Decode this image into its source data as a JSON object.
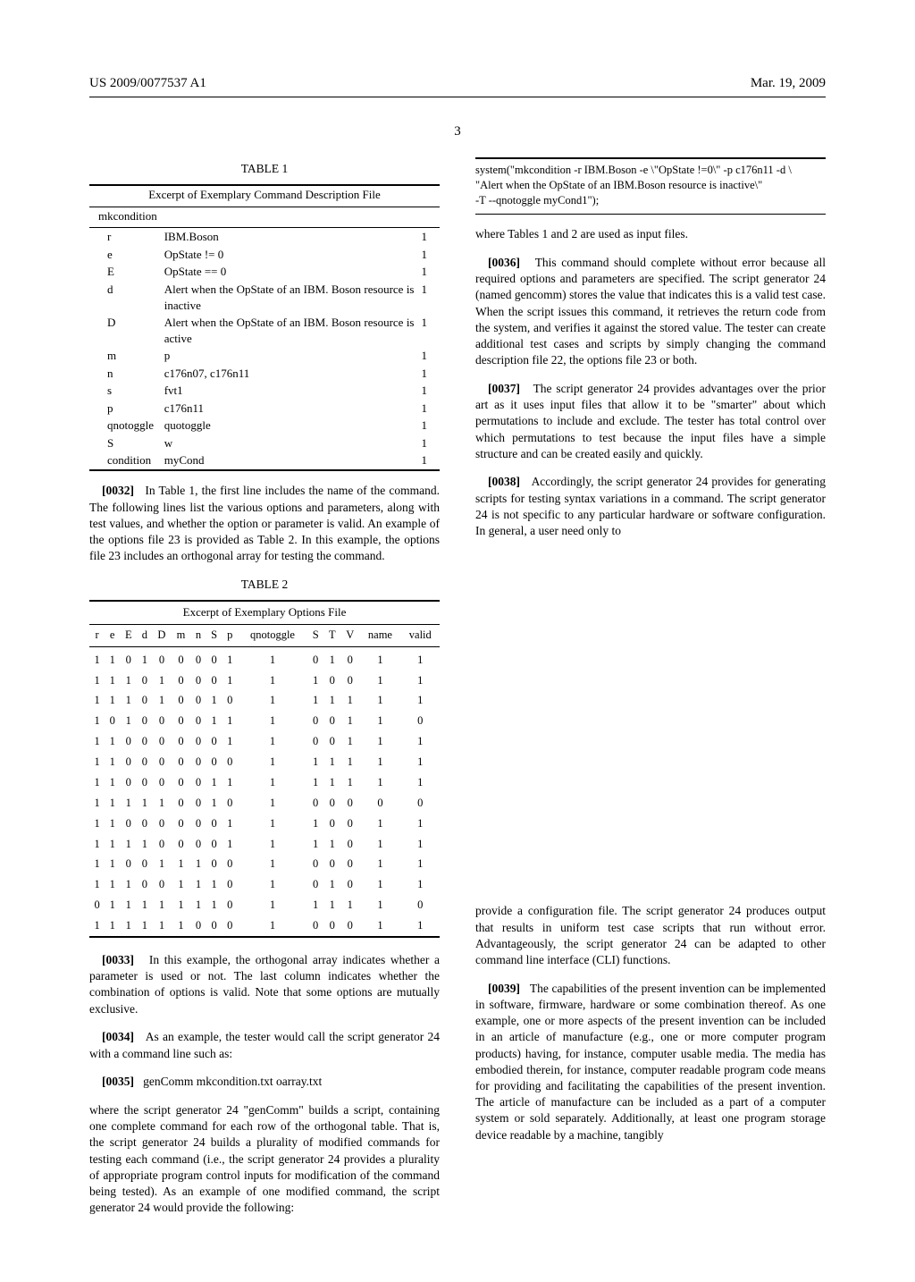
{
  "header": {
    "docnum": "US 2009/0077537 A1",
    "date": "Mar. 19, 2009",
    "page": "3"
  },
  "table1": {
    "title": "TABLE 1",
    "subtitle": "Excerpt of Exemplary Command Description File",
    "cmdname": "mkcondition",
    "rows": [
      {
        "opt": "r",
        "val": "IBM.Boson",
        "f": "1"
      },
      {
        "opt": "e",
        "val": "OpState != 0",
        "f": "1"
      },
      {
        "opt": "E",
        "val": "OpState == 0",
        "f": "1"
      },
      {
        "opt": "d",
        "val": "Alert when the OpState of an IBM. Boson resource is inactive",
        "f": "1"
      },
      {
        "opt": "D",
        "val": "Alert when the OpState of an IBM. Boson resource is active",
        "f": "1"
      },
      {
        "opt": "m",
        "val": "p",
        "f": "1"
      },
      {
        "opt": "n",
        "val": "c176n07, c176n11",
        "f": "1"
      },
      {
        "opt": "s",
        "val": "fvt1",
        "f": "1"
      },
      {
        "opt": "p",
        "val": "c176n11",
        "f": "1"
      },
      {
        "opt": "qnotoggle",
        "val": "quotoggle",
        "f": "1"
      },
      {
        "opt": "S",
        "val": "w",
        "f": "1"
      },
      {
        "opt": "condition",
        "val": "myCond",
        "f": "1"
      }
    ]
  },
  "para32": {
    "num": "[0032]",
    "text": "In Table 1, the first line includes the name of the command. The following lines list the various options and parameters, along with test values, and whether the option or parameter is valid. An example of the options file 23 is provided as Table 2. In this example, the options file 23 includes an orthogonal array for testing the command."
  },
  "table2": {
    "title": "TABLE 2",
    "subtitle": "Excerpt of Exemplary Options File",
    "headers": [
      "r",
      "e",
      "E",
      "d",
      "D",
      "m",
      "n",
      "S",
      "p",
      "qnotoggle",
      "S",
      "T",
      "V",
      "name",
      "valid"
    ]
  },
  "chart_data": {
    "type": "table",
    "columns": [
      "r",
      "e",
      "E",
      "d",
      "D",
      "m",
      "n",
      "S",
      "p",
      "qnotoggle",
      "S",
      "T",
      "V",
      "name",
      "valid"
    ],
    "rows": [
      [
        1,
        1,
        0,
        1,
        0,
        0,
        0,
        0,
        1,
        1,
        0,
        1,
        0,
        1,
        1
      ],
      [
        1,
        1,
        1,
        0,
        1,
        0,
        0,
        0,
        1,
        1,
        1,
        0,
        0,
        1,
        1
      ],
      [
        1,
        1,
        1,
        0,
        1,
        0,
        0,
        1,
        0,
        1,
        1,
        1,
        1,
        1,
        1
      ],
      [
        1,
        0,
        1,
        0,
        0,
        0,
        0,
        1,
        1,
        1,
        0,
        0,
        1,
        1,
        0
      ],
      [
        1,
        1,
        0,
        0,
        0,
        0,
        0,
        0,
        1,
        1,
        0,
        0,
        1,
        1,
        1
      ],
      [
        1,
        1,
        0,
        0,
        0,
        0,
        0,
        0,
        0,
        1,
        1,
        1,
        1,
        1,
        1
      ],
      [
        1,
        1,
        0,
        0,
        0,
        0,
        0,
        1,
        1,
        1,
        1,
        1,
        1,
        1,
        1
      ],
      [
        1,
        1,
        1,
        1,
        1,
        0,
        0,
        1,
        0,
        1,
        0,
        0,
        0,
        0,
        0
      ],
      [
        1,
        1,
        0,
        0,
        0,
        0,
        0,
        0,
        1,
        1,
        1,
        0,
        0,
        1,
        1
      ],
      [
        1,
        1,
        1,
        1,
        0,
        0,
        0,
        0,
        1,
        1,
        1,
        1,
        0,
        1,
        1
      ],
      [
        1,
        1,
        0,
        0,
        1,
        1,
        1,
        0,
        0,
        1,
        0,
        0,
        0,
        1,
        1
      ],
      [
        1,
        1,
        1,
        0,
        0,
        1,
        1,
        1,
        0,
        1,
        0,
        1,
        0,
        1,
        1
      ],
      [
        0,
        1,
        1,
        1,
        1,
        1,
        1,
        1,
        0,
        1,
        1,
        1,
        1,
        1,
        0
      ],
      [
        1,
        1,
        1,
        1,
        1,
        1,
        0,
        0,
        0,
        1,
        0,
        0,
        0,
        1,
        1
      ]
    ]
  },
  "para33": {
    "num": "[0033]",
    "text": "In this example, the orthogonal array indicates whether a parameter is used or not. The last column indicates whether the combination of options is valid. Note that some options are mutually exclusive."
  },
  "para34": {
    "num": "[0034]",
    "text": "As an example, the tester would call the script generator 24 with a command line such as:"
  },
  "para35": {
    "num": "[0035]",
    "cmdline": "genComm mkcondition.txt oarray.txt",
    "text": "where the script generator 24 \"genComm\" builds a script, containing one complete command for each row of the orthogonal table. That is, the script generator 24 builds a plurality of modified commands for testing each command (i.e., the script generator 24 provides a plurality of appropriate program control inputs for modification of the command being tested). As an example of one modified command, the script generator 24 would provide the following:"
  },
  "codebox": {
    "l1": "system(\"mkcondition -r IBM.Boson -e \\\"OpState !=0\\\" -p c176n11 -d \\",
    "l2": "\"Alert when the OpState of an IBM.Boson resource is inactive\\\"",
    "l3": "-T --qnotoggle myCond1\");"
  },
  "para35b": "where Tables 1 and 2 are used as input files.",
  "para36": {
    "num": "[0036]",
    "text": "This command should complete without error because all required options and parameters are specified. The script generator 24 (named gencomm) stores the value that indicates this is a valid test case. When the script issues this command, it retrieves the return code from the system, and verifies it against the stored value. The tester can create additional test cases and scripts by simply changing the command description file 22, the options file 23 or both."
  },
  "para37": {
    "num": "[0037]",
    "text": "The script generator 24 provides advantages over the prior art as it uses input files that allow it to be \"smarter\" about which permutations to include and exclude. The tester has total control over which permutations to test because the input files have a simple structure and can be created easily and quickly."
  },
  "para38": {
    "num": "[0038]",
    "text": "Accordingly, the script generator 24 provides for generating scripts for testing syntax variations in a command. The script generator 24 is not specific to any particular hardware or software configuration. In general, a user need only to"
  },
  "para38b": "provide a configuration file. The script generator 24 produces output that results in uniform test case scripts that run without error. Advantageously, the script generator 24 can be adapted to other command line interface (CLI) functions.",
  "para39": {
    "num": "[0039]",
    "text": "The capabilities of the present invention can be implemented in software, firmware, hardware or some combination thereof. As one example, one or more aspects of the present invention can be included in an article of manufacture (e.g., one or more computer program products) having, for instance, computer usable media. The media has embodied therein, for instance, computer readable program code means for providing and facilitating the capabilities of the present invention. The article of manufacture can be included as a part of a computer system or sold separately. Additionally, at least one program storage device readable by a machine, tangibly"
  }
}
